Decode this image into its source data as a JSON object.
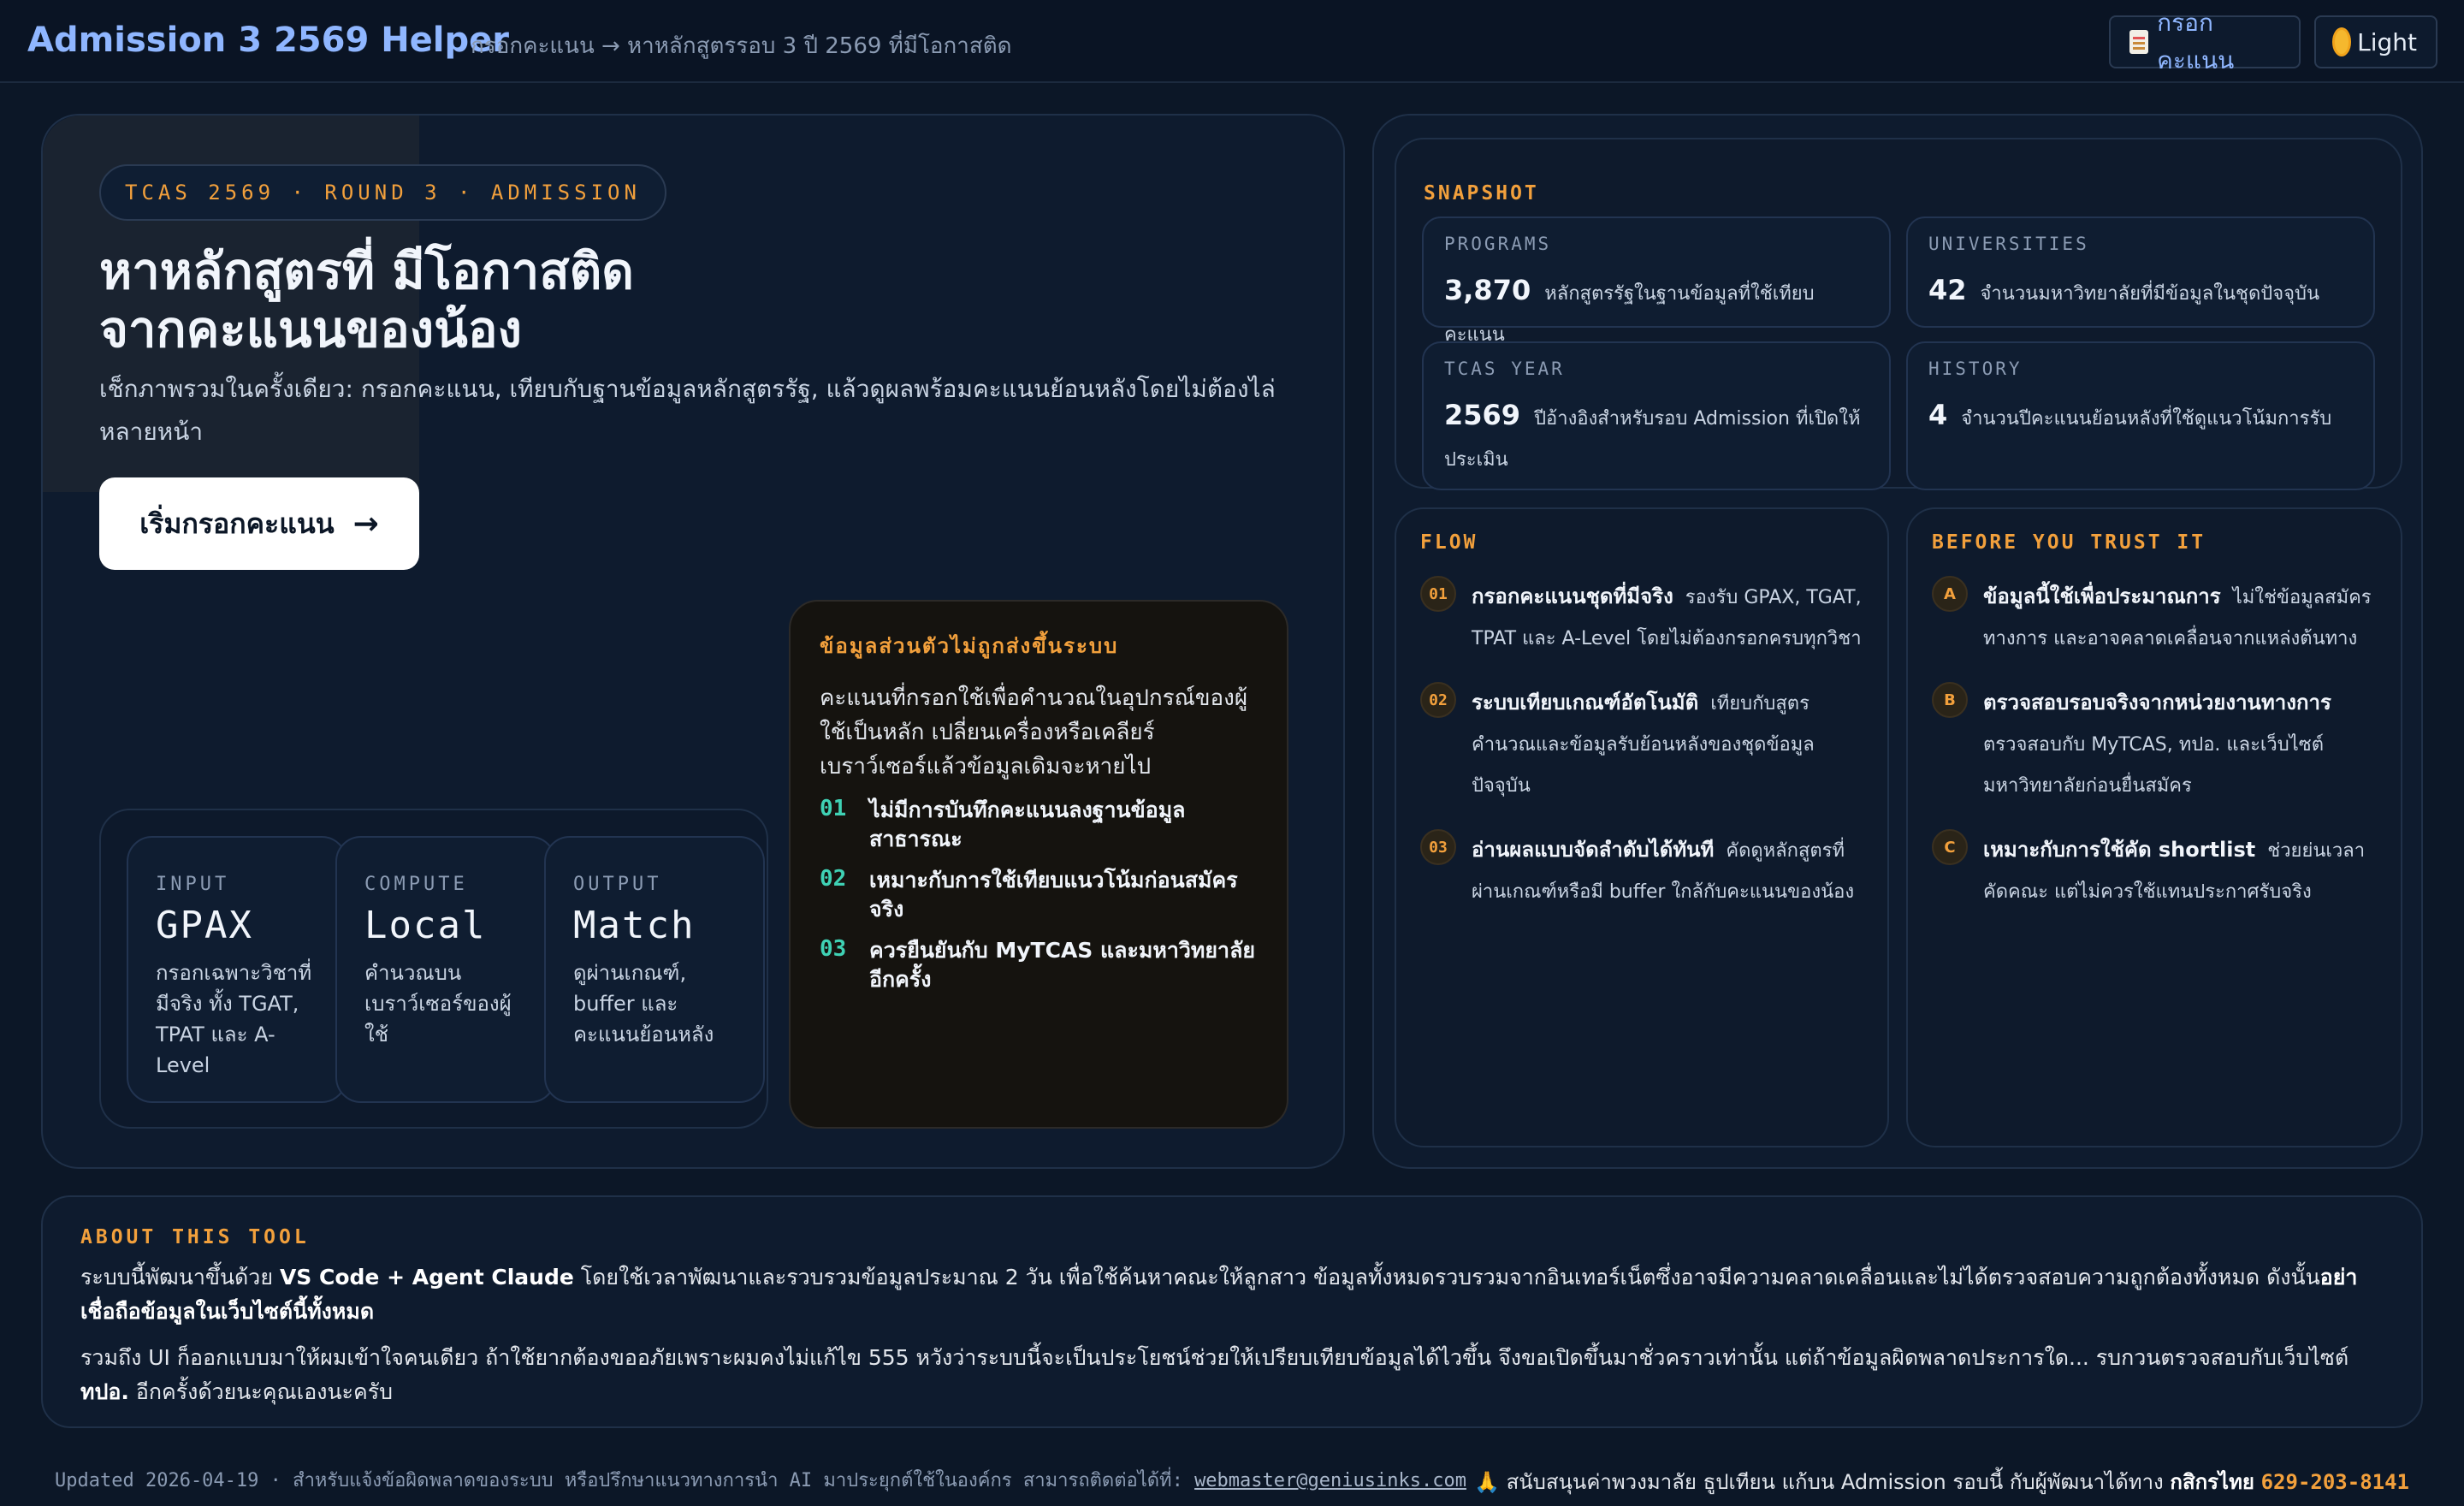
{
  "header": {
    "brand": "Admission 3 2569 Helper",
    "breadcrumb": "กรอกคะแนน → หาหลักสูตรรอบ 3 ปี 2569 ที่มีโอกาสติด",
    "score_button": "กรอกคะแนน",
    "score_icon": "document-icon",
    "theme_button": "Light",
    "theme_icon": "sun-icon"
  },
  "hero": {
    "tag": "TCAS 2569 · ROUND 3 · ADMISSION",
    "title_line1": "หาหลักสูตรที่ มีโอกาสติด",
    "title_line2": "จากคะแนนของน้อง",
    "subtitle": "เช็กภาพรวมในครั้งเดียว: กรอกคะแนน, เทียบกับฐานข้อมูลหลักสูตรรัฐ, แล้วดูผลพร้อมคะแนนย้อนหลังโดยไม่ต้องไล่หลายหน้า",
    "cta": "เริ่มกรอกคะแนน",
    "cta_arrow": "→"
  },
  "io_cards": [
    {
      "key": "INPUT",
      "value": "GPAX",
      "desc": "กรอกเฉพาะวิชาที่มีจริง ทั้ง TGAT, TPAT และ A-Level"
    },
    {
      "key": "COMPUTE",
      "value": "Local",
      "desc": "คำนวณบนเบราว์เซอร์ของผู้ใช้"
    },
    {
      "key": "OUTPUT",
      "value": "Match",
      "desc": "ดูผ่านเกณฑ์, buffer และคะแนนย้อนหลัง"
    }
  ],
  "privacy": {
    "heading": "ข้อมูลส่วนตัวไม่ถูกส่งขึ้นระบบ",
    "body": "คะแนนที่กรอกใช้เพื่อคำนวณในอุปกรณ์ของผู้ใช้เป็นหลัก เปลี่ยนเครื่องหรือเคลียร์เบราว์เซอร์แล้วข้อมูลเดิมจะหายไป",
    "items": [
      {
        "n": "01",
        "text": "ไม่มีการบันทึกคะแนนลงฐานข้อมูลสาธารณะ"
      },
      {
        "n": "02",
        "text": "เหมาะกับการใช้เทียบแนวโน้มก่อนสมัครจริง"
      },
      {
        "n": "03",
        "text": "ควรยืนยันกับ MyTCAS และมหาวิทยาลัยอีกครั้ง"
      }
    ]
  },
  "snapshot": {
    "heading": "SNAPSHOT",
    "stats": [
      {
        "key": "PROGRAMS",
        "value": "3,870",
        "desc": "หลักสูตรรัฐในฐานข้อมูลที่ใช้เทียบคะแนน"
      },
      {
        "key": "UNIVERSITIES",
        "value": "42",
        "desc": "จำนวนมหาวิทยาลัยที่มีข้อมูลในชุดปัจจุบัน"
      },
      {
        "key": "TCAS YEAR",
        "value": "2569",
        "desc": "ปีอ้างอิงสำหรับรอบ Admission ที่เปิดให้ประเมิน"
      },
      {
        "key": "HISTORY",
        "value": "4",
        "desc": "จำนวนปีคะแนนย้อนหลังที่ใช้ดูแนวโน้มการรับ"
      }
    ]
  },
  "flow": {
    "heading": "FLOW",
    "steps": [
      {
        "n": "01",
        "title": "กรอกคะแนนชุดที่มีจริง",
        "text": "รองรับ GPAX, TGAT, TPAT และ A-Level โดยไม่ต้องกรอกครบทุกวิชา"
      },
      {
        "n": "02",
        "title": "ระบบเทียบเกณฑ์อัตโนมัติ",
        "text": "เทียบกับสูตรคำนวณและข้อมูลรับย้อนหลังของชุดข้อมูลปัจจุบัน"
      },
      {
        "n": "03",
        "title": "อ่านผลแบบจัดลำดับได้ทันที",
        "text": "คัดดูหลักสูตรที่ผ่านเกณฑ์หรือมี buffer ใกล้กับคะแนนของน้อง"
      }
    ]
  },
  "trust": {
    "heading": "BEFORE YOU TRUST IT",
    "steps": [
      {
        "n": "A",
        "title": "ข้อมูลนี้ใช้เพื่อประมาณการ",
        "text": "ไม่ใช่ข้อมูลสมัครทางการ และอาจคลาดเคลื่อนจากแหล่งต้นทาง"
      },
      {
        "n": "B",
        "title": "ตรวจสอบรอบจริงจากหน่วยงานทางการ",
        "text": "ตรวจสอบกับ MyTCAS, ทปอ. และเว็บไซต์มหาวิทยาลัยก่อนยื่นสมัคร"
      },
      {
        "n": "C",
        "title": "เหมาะกับการใช้คัด shortlist",
        "text": "ช่วยย่นเวลาคัดคณะ แต่ไม่ควรใช้แทนประกาศรับจริง"
      }
    ]
  },
  "about": {
    "heading": "ABOUT THIS TOOL",
    "p1_a": "ระบบนี้พัฒนาขึ้นด้วย ",
    "p1_b": "VS Code + Agent Claude",
    "p1_c": " โดยใช้เวลาพัฒนาและรวบรวมข้อมูลประมาณ 2 วัน เพื่อใช้ค้นหาคณะให้ลูกสาว ข้อมูลทั้งหมดรวบรวมจากอินเทอร์เน็ตซึ่งอาจมีความคลาดเคลื่อนและไม่ได้ตรวจสอบความถูกต้องทั้งหมด ดังนั้น",
    "p1_d": "อย่าเชื่อถือข้อมูลในเว็บไซต์นี้ทั้งหมด",
    "p2_a": "รวมถึง UI ก็ออกแบบมาให้ผมเข้าใจคนเดียว ถ้าใช้ยากต้องขออภัยเพราะผมคงไม่แก้ไข 555 หวังว่าระบบนี้จะเป็นประโยชน์ช่วยให้เปรียบเทียบข้อมูลได้ไวขึ้น จึงขอเปิดขึ้นมาชั่วคราวเท่านั้น แต่ถ้าข้อมูลผิดพลาดประการใด... รบกวนตรวจสอบกับเว็บไซต์ ",
    "p2_b": "ทปอ.",
    "p2_c": " อีกครั้งด้วยนะคุณเองนะครับ"
  },
  "footer": {
    "left": "Updated 2026-04-19 · สำหรับแจ้งข้อผิดพลาดของระบบ หรือปรึกษาแนวทางการนำ AI มาประยุกต์ใช้ในองค์กร สามารถติดต่อได้ที่: ",
    "email": "webmaster@geniusinks.com",
    "right_a": "🙏 สนับสนุนค่าพวงมาลัย ธูปเทียน แก้บน Admission รอบนี้ กับผู้พัฒนาได้ทาง ",
    "bank": "กสิกรไทย",
    "account": "629-203-8141"
  }
}
